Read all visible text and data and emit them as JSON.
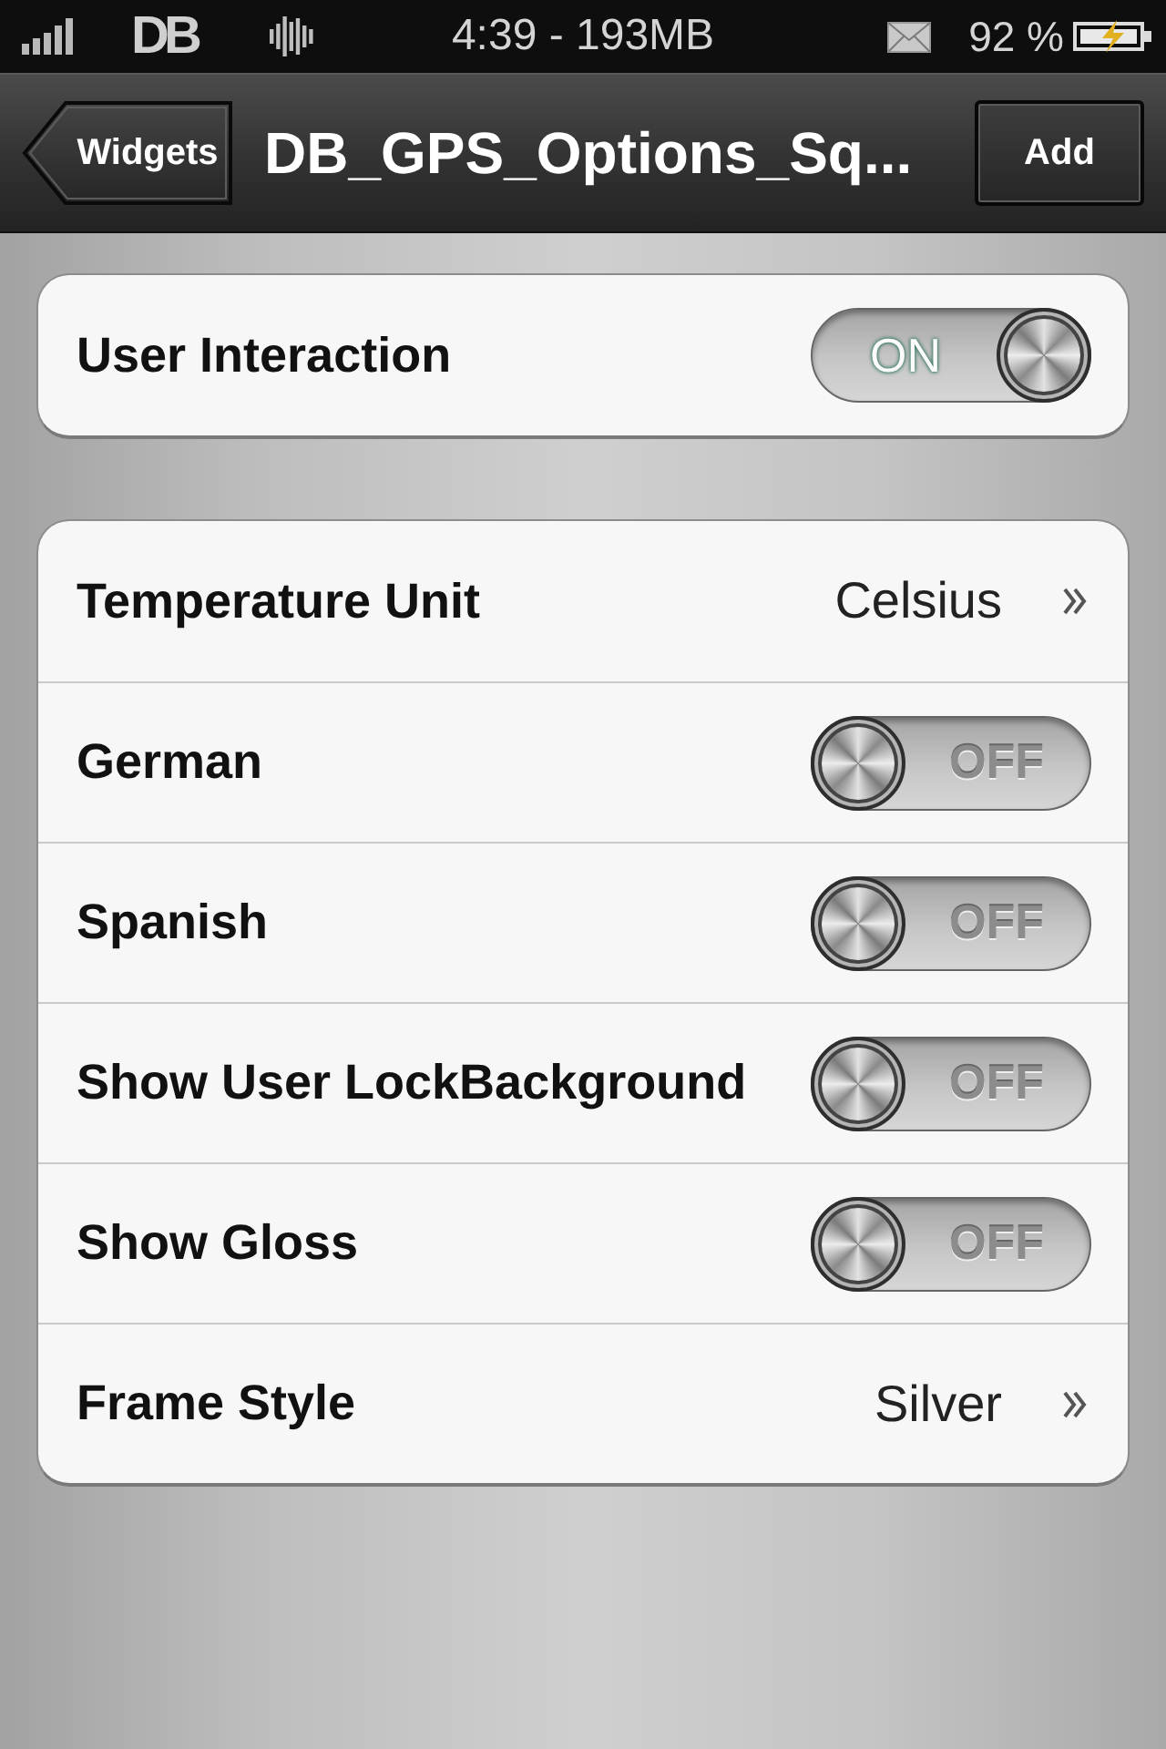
{
  "status_bar": {
    "logo": "DB",
    "time": "4:39 - 193MB",
    "battery": "92 %"
  },
  "nav_bar": {
    "back_button": "Widgets",
    "title": "DB_GPS_Options_Sq...",
    "action_button": "Add"
  },
  "groups": [
    {
      "rows": [
        {
          "kind": "toggle",
          "label": "User Interaction",
          "on": true,
          "state_text": "ON"
        }
      ]
    },
    {
      "rows": [
        {
          "kind": "disclosure",
          "label": "Temperature Unit",
          "value": "Celsius"
        },
        {
          "kind": "toggle",
          "label": "German",
          "on": false,
          "state_text": "OFF"
        },
        {
          "kind": "toggle",
          "label": "Spanish",
          "on": false,
          "state_text": "OFF"
        },
        {
          "kind": "toggle",
          "label": "Show User LockBackground",
          "on": false,
          "state_text": "OFF"
        },
        {
          "kind": "toggle",
          "label": "Show Gloss",
          "on": false,
          "state_text": "OFF"
        },
        {
          "kind": "disclosure",
          "label": "Frame Style",
          "value": "Silver"
        }
      ]
    }
  ]
}
